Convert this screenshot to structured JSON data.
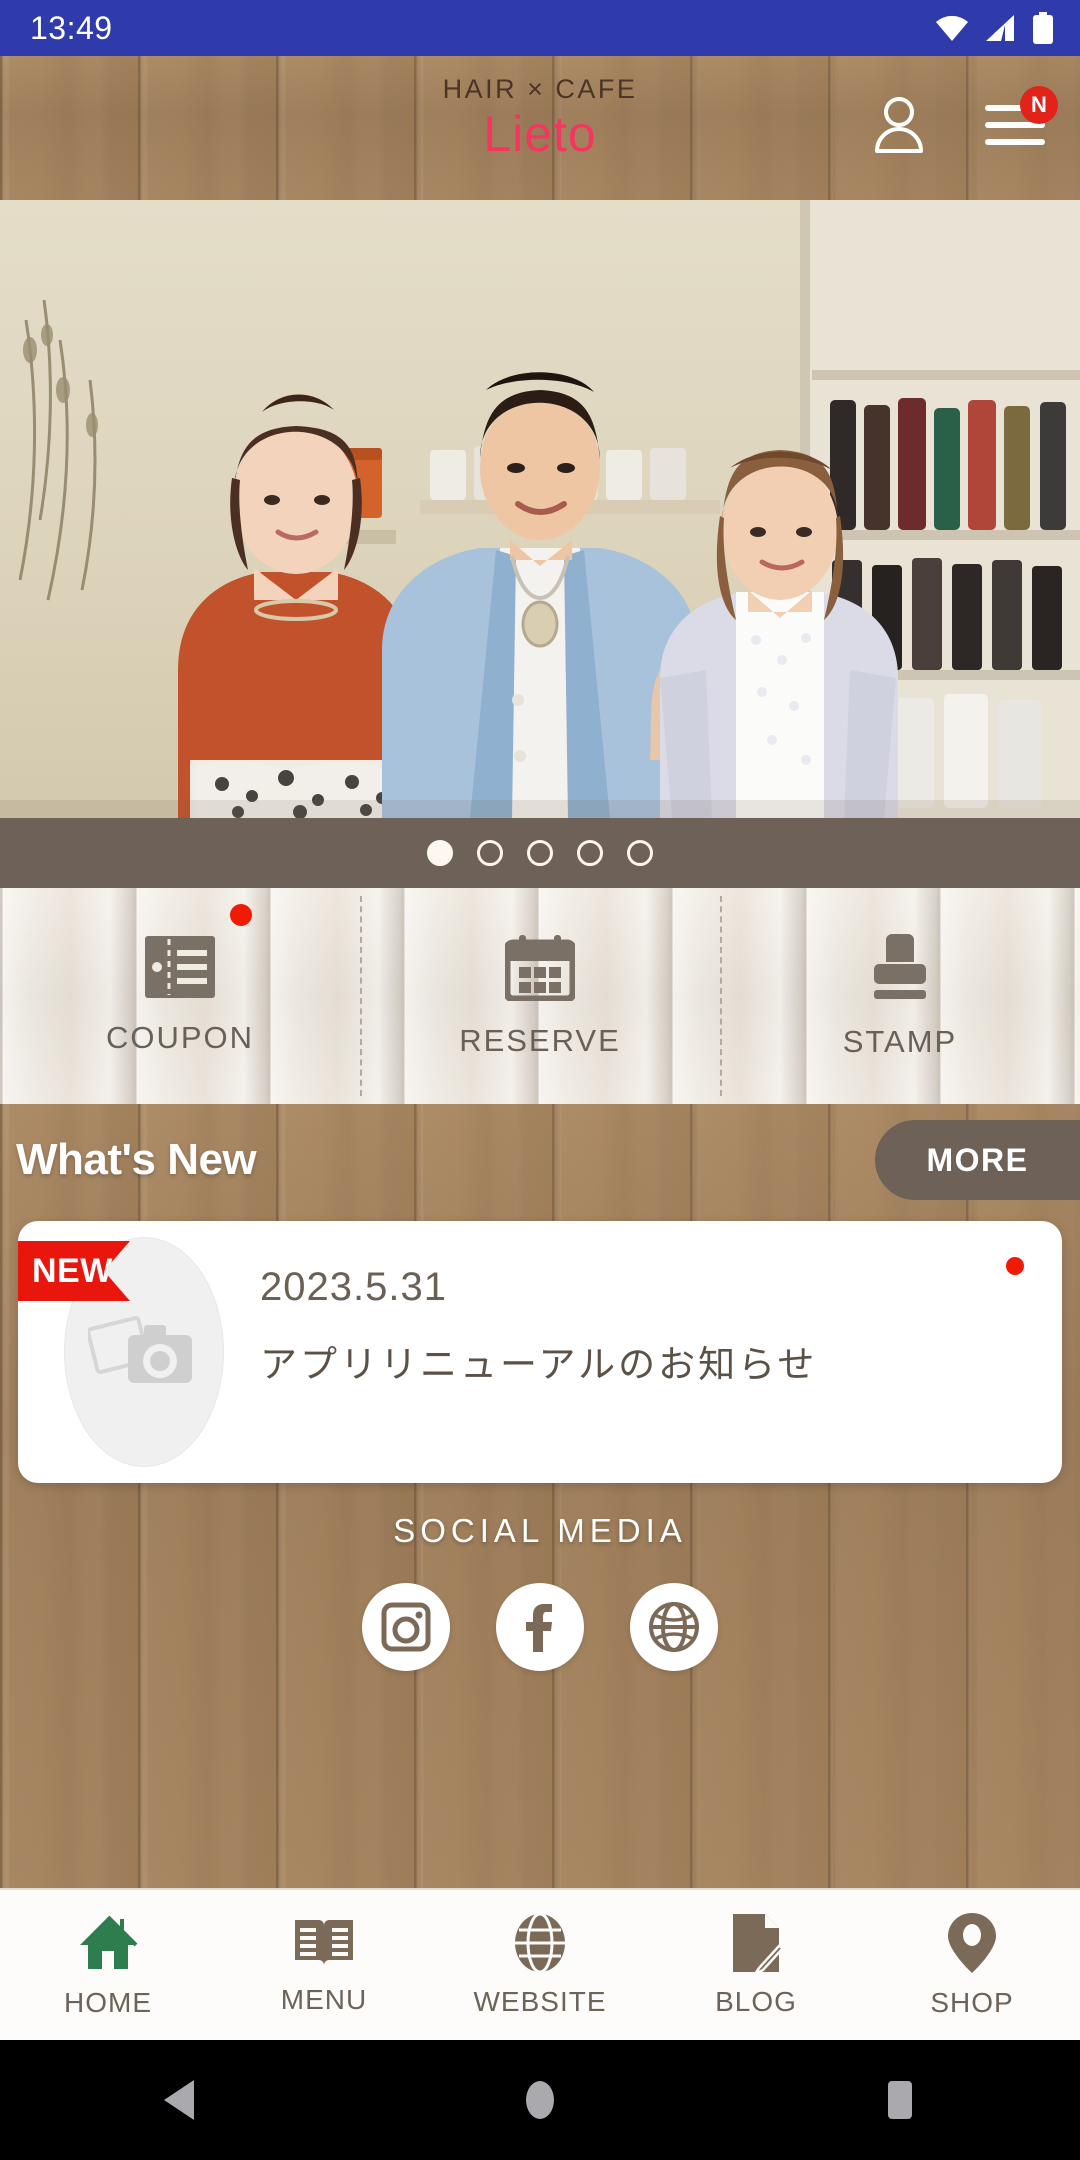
{
  "statusbar": {
    "time": "13:49",
    "icons": [
      "wifi-icon",
      "cellular-signal-icon",
      "battery-icon"
    ],
    "background_color": "#2f3bab"
  },
  "header": {
    "logo_top": "HAIR × CAFE",
    "logo_main": "Lieto",
    "logo_main_color": "#f4365f",
    "account_icon": "person-icon",
    "menu_icon": "hamburger-menu-icon",
    "menu_badge": "N",
    "menu_badge_color": "#e2231a"
  },
  "hero": {
    "alt": "three salon staff standing in hair salon interior",
    "carousel_dots_total": 5,
    "carousel_active_index": 0,
    "dots_bar_color": "#6d6158"
  },
  "quick_actions": [
    {
      "label": "COUPON",
      "icon": "coupon-ticket-icon",
      "badge": true
    },
    {
      "label": "RESERVE",
      "icon": "calendar-icon",
      "badge": false
    },
    {
      "label": "STAMP",
      "icon": "stamp-icon",
      "badge": false
    }
  ],
  "whats_new": {
    "title": "What's New",
    "more_label": "MORE",
    "more_color": "#6d6158",
    "items": [
      {
        "ribbon": "NEW",
        "ribbon_color": "#e8160c",
        "date": "2023.5.31",
        "text": "アプリリニューアルのお知らせ",
        "thumb_icon": "photo-camera-placeholder-icon",
        "unread": true
      }
    ]
  },
  "social": {
    "title": "SOCIAL MEDIA",
    "links": [
      {
        "name": "instagram-icon",
        "label": "Instagram"
      },
      {
        "name": "facebook-icon",
        "label": "Facebook"
      },
      {
        "name": "website-globe-icon",
        "label": "Website"
      }
    ]
  },
  "bottom_nav": {
    "active_index": 0,
    "active_color": "#2e7d4f",
    "inactive_color": "#6e6359",
    "items": [
      {
        "label": "HOME",
        "icon": "home-icon"
      },
      {
        "label": "MENU",
        "icon": "book-icon"
      },
      {
        "label": "WEBSITE",
        "icon": "globe-icon"
      },
      {
        "label": "BLOG",
        "icon": "document-pen-icon"
      },
      {
        "label": "SHOP",
        "icon": "map-pin-icon"
      }
    ]
  },
  "android_nav": {
    "buttons": [
      {
        "name": "back-button",
        "icon": "triangle-back-icon"
      },
      {
        "name": "home-button",
        "icon": "circle-home-icon"
      },
      {
        "name": "recents-button",
        "icon": "square-recents-icon"
      }
    ]
  }
}
